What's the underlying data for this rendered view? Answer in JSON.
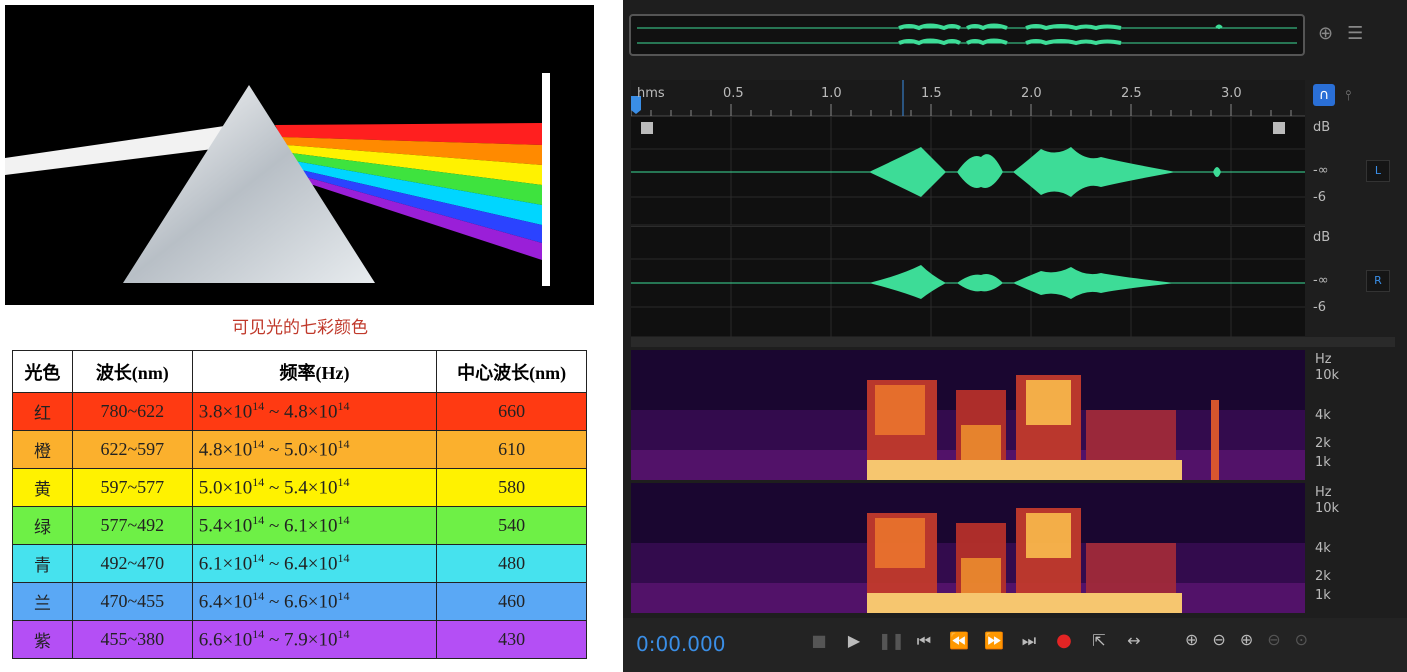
{
  "prism_panel": {
    "caption": "可见光的七彩颜色"
  },
  "spectrum_table": {
    "headers": [
      "光色",
      "波长(nm)",
      "频率(Hz)",
      "中心波长(nm)"
    ],
    "rows": [
      {
        "name": "红",
        "wavelength": "780~622",
        "freq_a": "3.8×10",
        "freq_a_exp": "14",
        "freq_b": "4.8×10",
        "freq_b_exp": "14",
        "center": "660",
        "color": "#ff3a12"
      },
      {
        "name": "橙",
        "wavelength": "622~597",
        "freq_a": "4.8×10",
        "freq_a_exp": "14",
        "freq_b": "5.0×10",
        "freq_b_exp": "14",
        "center": "610",
        "color": "#fbb02d"
      },
      {
        "name": "黄",
        "wavelength": "597~577",
        "freq_a": "5.0×10",
        "freq_a_exp": "14",
        "freq_b": "5.4×10",
        "freq_b_exp": "14",
        "center": "580",
        "color": "#fff200"
      },
      {
        "name": "绿",
        "wavelength": "577~492",
        "freq_a": "5.4×10",
        "freq_a_exp": "14",
        "freq_b": "6.1×10",
        "freq_b_exp": "14",
        "center": "540",
        "color": "#6ef046"
      },
      {
        "name": "青",
        "wavelength": "492~470",
        "freq_a": "6.1×10",
        "freq_a_exp": "14",
        "freq_b": "6.4×10",
        "freq_b_exp": "14",
        "center": "480",
        "color": "#46e2ee"
      },
      {
        "name": "兰",
        "wavelength": "470~455",
        "freq_a": "6.4×10",
        "freq_a_exp": "14",
        "freq_b": "6.6×10",
        "freq_b_exp": "14",
        "center": "460",
        "color": "#5aa8f5"
      },
      {
        "name": "紫",
        "wavelength": "455~380",
        "freq_a": "6.6×10",
        "freq_a_exp": "14",
        "freq_b": "7.9×10",
        "freq_b_exp": "14",
        "center": "430",
        "color": "#b44ff5"
      }
    ]
  },
  "editor": {
    "ruler": {
      "unit": "hms",
      "ticks": [
        "0.5",
        "1.0",
        "1.5",
        "2.0",
        "2.5",
        "3.0"
      ]
    },
    "waveform": {
      "unit": "dB",
      "labels": [
        "-∞",
        "-6"
      ],
      "channels": [
        "L",
        "R"
      ]
    },
    "spectrogram": {
      "unit": "Hz",
      "labels": [
        "10k",
        "4k",
        "2k",
        "1k"
      ]
    },
    "transport": {
      "timecode": "0:00.000"
    },
    "colors": {
      "accent": "#3a8ee6",
      "waveform": "#3ddc97",
      "record": "#e32424"
    }
  }
}
